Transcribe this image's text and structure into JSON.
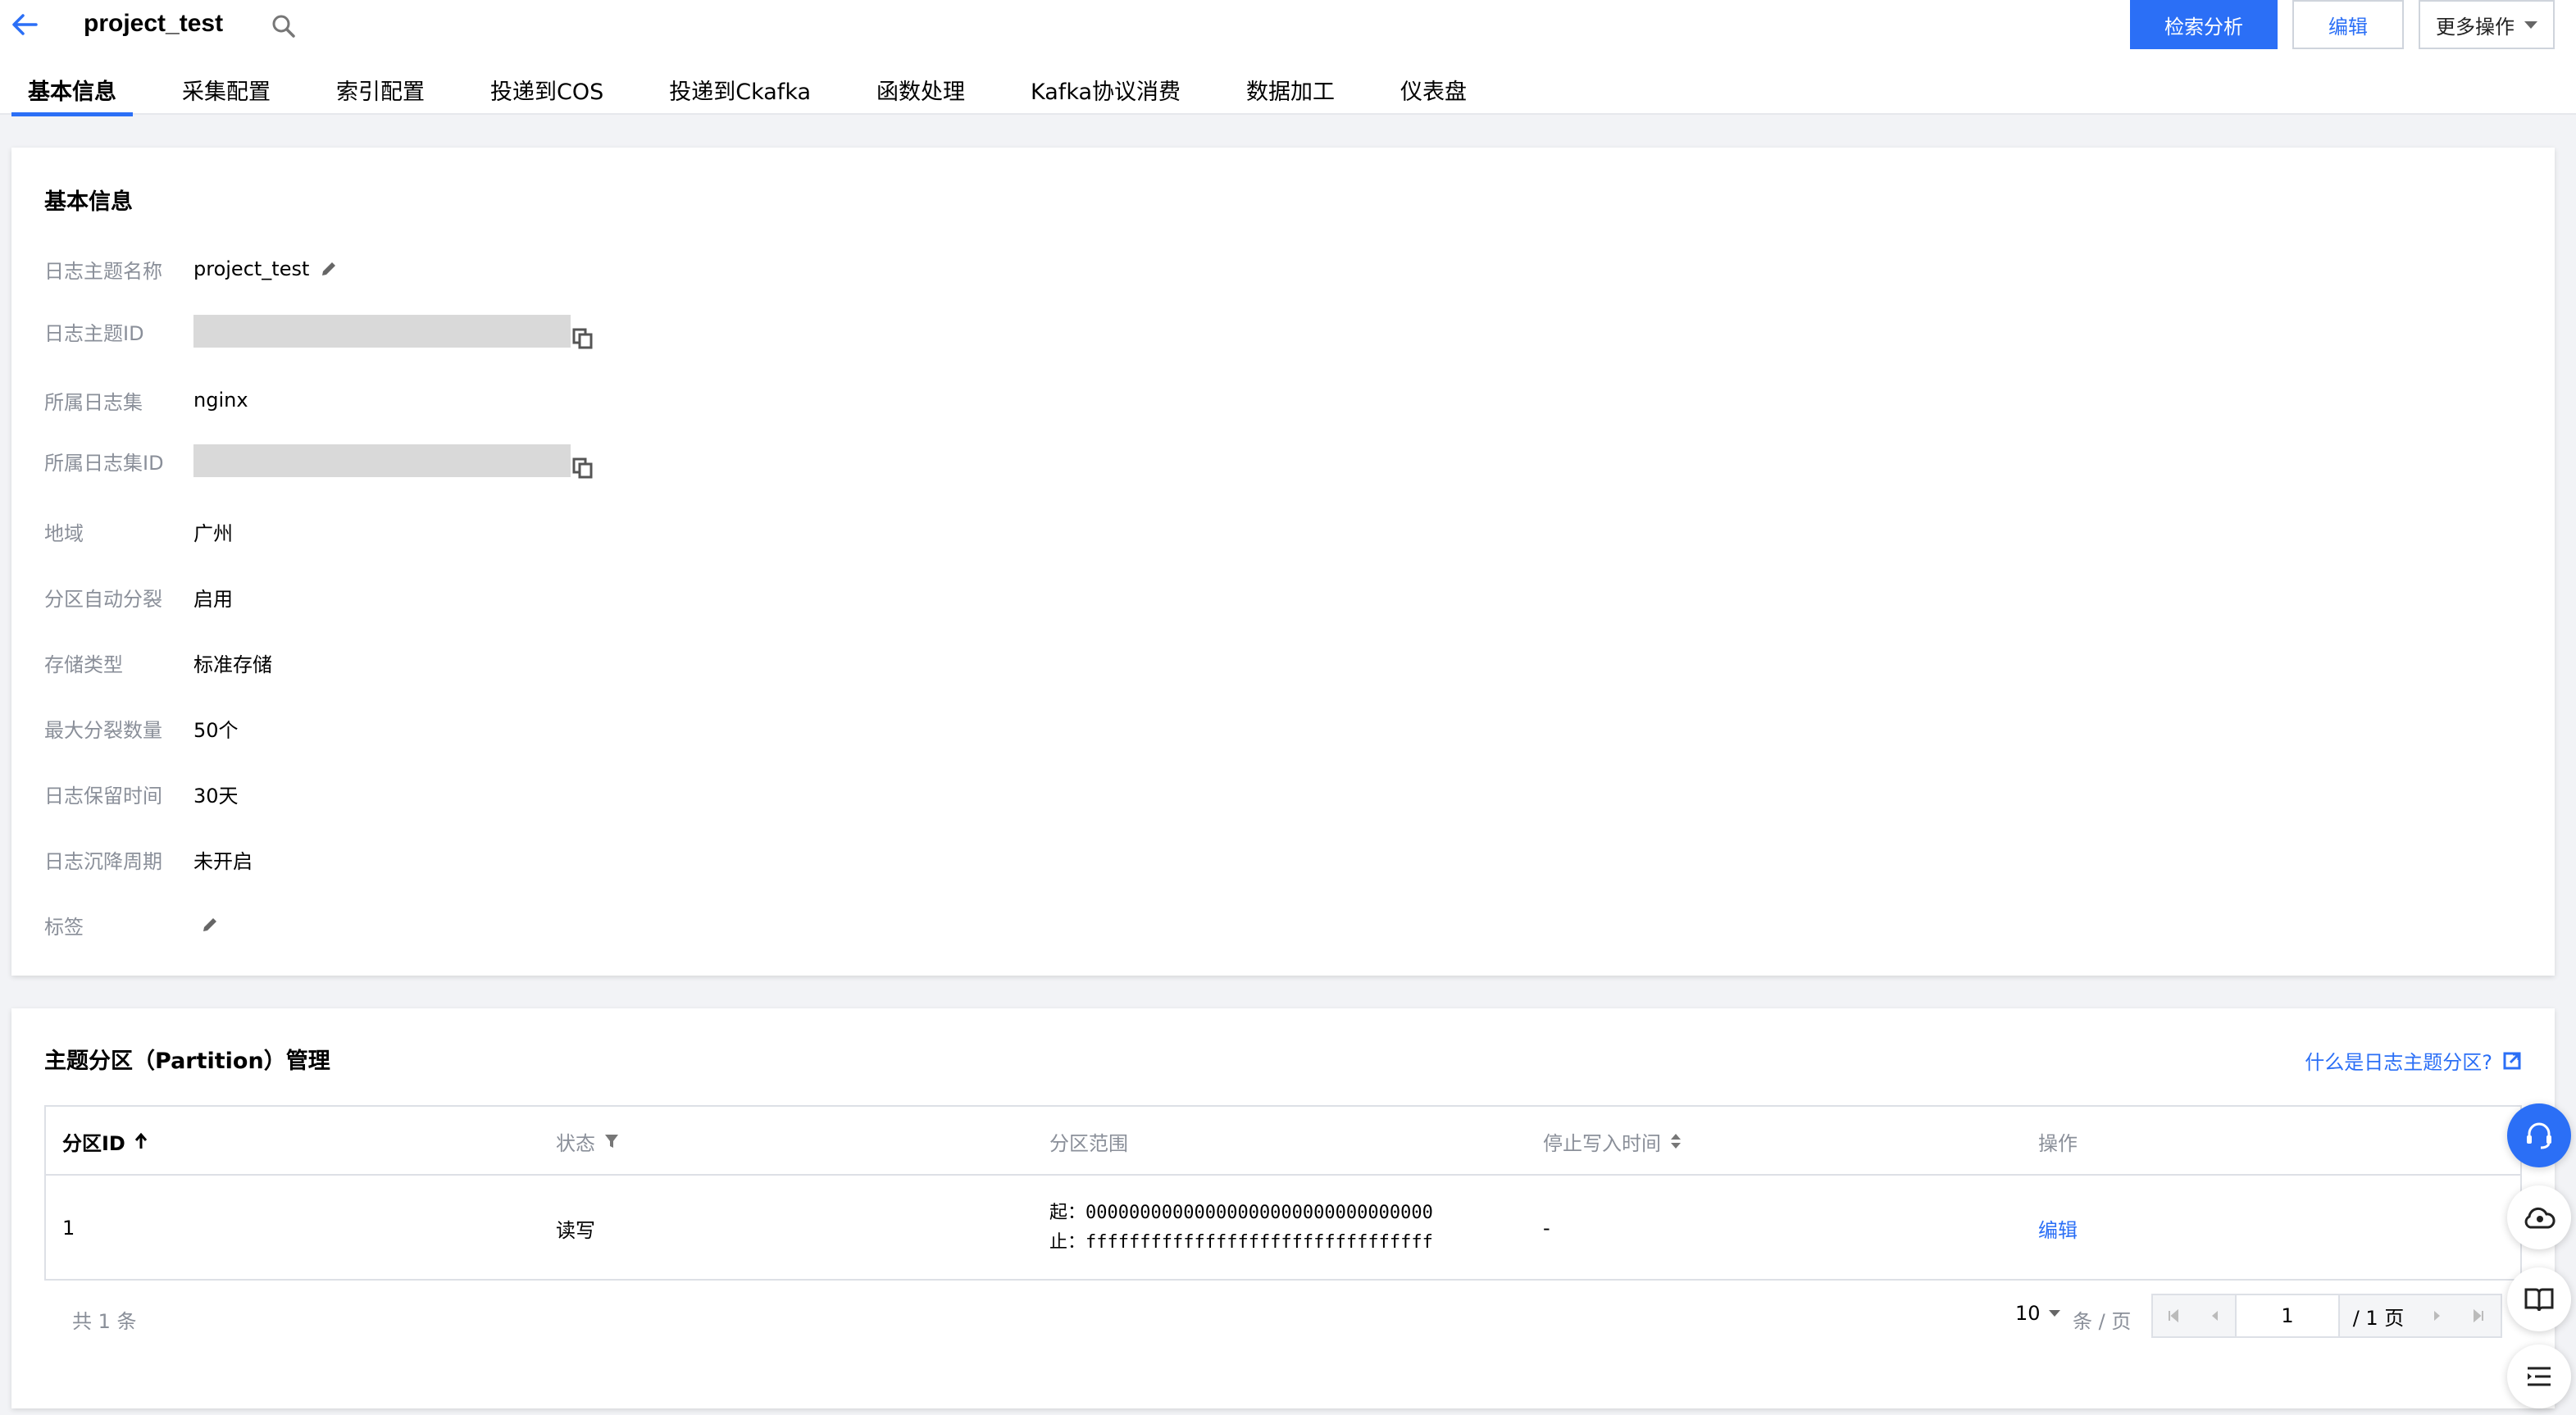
{
  "header": {
    "title": "project_test",
    "buttons": {
      "search_analysis": "检索分析",
      "edit": "编辑",
      "more": "更多操作"
    }
  },
  "tabs": [
    {
      "label": "基本信息",
      "active": true
    },
    {
      "label": "采集配置"
    },
    {
      "label": "索引配置"
    },
    {
      "label": "投递到COS"
    },
    {
      "label": "投递到Ckafka"
    },
    {
      "label": "函数处理"
    },
    {
      "label": "Kafka协议消费"
    },
    {
      "label": "数据加工"
    },
    {
      "label": "仪表盘"
    }
  ],
  "basic_info": {
    "title": "基本信息",
    "rows": [
      {
        "label": "日志主题名称",
        "value": "project_test"
      },
      {
        "label": "日志主题ID",
        "value": ""
      },
      {
        "label": "所属日志集",
        "value": "nginx"
      },
      {
        "label": "所属日志集ID",
        "value": ""
      },
      {
        "label": "地域",
        "value": "广州"
      },
      {
        "label": "分区自动分裂",
        "value": "启用"
      },
      {
        "label": "存储类型",
        "value": "标准存储"
      },
      {
        "label": "最大分裂数量",
        "value": "50个"
      },
      {
        "label": "日志保留时间",
        "value": "30天"
      },
      {
        "label": "日志沉降周期",
        "value": "未开启"
      },
      {
        "label": "标签",
        "value": ""
      }
    ]
  },
  "partition": {
    "title": "主题分区（Partition）管理",
    "help_link": "什么是日志主题分区?",
    "columns": [
      "分区ID",
      "状态",
      "分区范围",
      "停止写入时间",
      "操作"
    ],
    "rows": [
      {
        "id": "1",
        "status": "读写",
        "range_start_prefix": "起：",
        "range_start": "00000000000000000000000000000000",
        "range_end_prefix": "止：",
        "range_end": "ffffffffffffffffffffffffffffffff",
        "stop_time": "-",
        "action": "编辑"
      }
    ],
    "total": "共 1 条",
    "page_size": "10",
    "per_page_label": "条 / 页",
    "current_page": "1",
    "total_pages": "/ 1 页"
  },
  "colors": {
    "accent": "#2b6ff6",
    "label_gray": "#8a8f99",
    "page_bg": "#f2f3f6"
  },
  "icons": [
    "back-arrow-icon",
    "search-icon",
    "pencil-icon",
    "copy-icon",
    "sort-asc-icon",
    "filter-icon",
    "sort-icon",
    "external-link-icon",
    "headset-icon",
    "cloud-bell-icon",
    "book-icon",
    "list-icon"
  ]
}
